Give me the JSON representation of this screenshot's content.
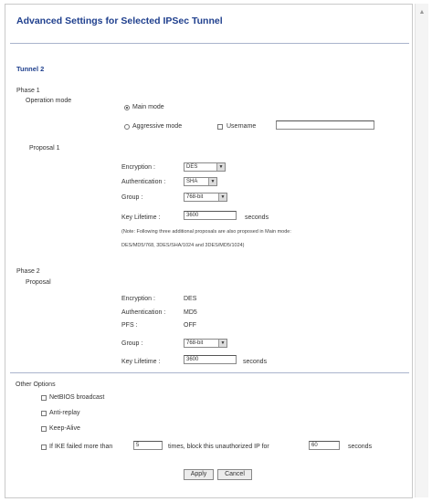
{
  "page": {
    "title": "Advanced Settings for Selected IPSec Tunnel",
    "tunnel_label": "Tunnel 2"
  },
  "phase1": {
    "label": "Phase 1",
    "operation_mode_label": "Operation mode",
    "main_mode_label": "Main mode",
    "aggressive_mode_label": "Aggressive mode",
    "username_label": "Username",
    "username_value": "",
    "proposal_label": "Proposal 1",
    "encryption_label": "Encryption :",
    "encryption_value": "DES",
    "authentication_label": "Authentication :",
    "authentication_value": "SHA",
    "group_label": "Group :",
    "group_value": "768-bit",
    "key_lifetime_label": "Key Lifetime :",
    "key_lifetime_value": "3600",
    "seconds_label": "seconds",
    "note_line1": "(Note: Following three additional proposals are also proposed in Main mode:",
    "note_line2": "DES/MD5/768, 3DES/SHA/1024 and 3DES/MD5/1024)"
  },
  "phase2": {
    "label": "Phase 2",
    "proposal_label": "Proposal",
    "encryption_label": "Encryption :",
    "encryption_value": "DES",
    "authentication_label": "Authentication :",
    "authentication_value": "MD5",
    "pfs_label": "PFS :",
    "pfs_value": "OFF",
    "group_label": "Group :",
    "group_value": "768-bit",
    "key_lifetime_label": "Key Lifetime :",
    "key_lifetime_value": "3600",
    "seconds_label": "seconds"
  },
  "other": {
    "label": "Other Options",
    "netbios_label": "NetBIOS broadcast",
    "antireplay_label": "Anti-replay",
    "keepalive_label": "Keep-Alive",
    "ike_prefix": "If IKE failed more than",
    "ike_times_value": "5",
    "ike_middle": "times, block this unauthorized IP for",
    "ike_seconds_value": "60",
    "ike_suffix": "seconds"
  },
  "buttons": {
    "apply": "Apply",
    "cancel": "Cancel"
  }
}
